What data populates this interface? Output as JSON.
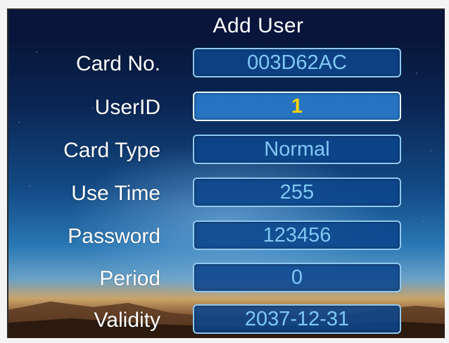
{
  "header": {
    "title": "Add User"
  },
  "form": {
    "fields": [
      {
        "label": "Card No.",
        "value": "003D62AC"
      },
      {
        "label": "UserID",
        "value": "1"
      },
      {
        "label": "Card Type",
        "value": "Normal"
      },
      {
        "label": "Use Time",
        "value": "255"
      },
      {
        "label": "Password",
        "value": "123456"
      },
      {
        "label": "Period",
        "value": "0"
      },
      {
        "label": "Validity",
        "value": "2037-12-31"
      }
    ],
    "selected_field": "UserID"
  },
  "colors": {
    "title_bar": "#0a163c",
    "field_bg": "#0c468c",
    "field_border": "#8fc8f0",
    "field_text": "#7fc8f4",
    "selected_text": "#ffd200",
    "label_text": "#ffffff"
  }
}
